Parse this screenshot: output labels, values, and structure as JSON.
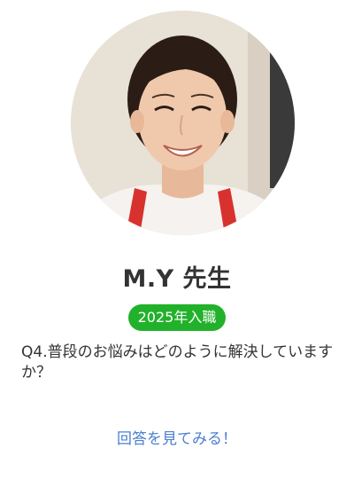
{
  "profile": {
    "name": "M.Y 先生",
    "badge": "2025年入職",
    "photo": "teacher-portrait-photo"
  },
  "question": {
    "text": "Q4.普段のお悩みはどのように解決していますか？"
  },
  "answer_link": {
    "label": "回答を見てみる！"
  },
  "colors": {
    "badge_bg": "#22b12b",
    "link": "#4a7fd0",
    "text": "#333333"
  }
}
